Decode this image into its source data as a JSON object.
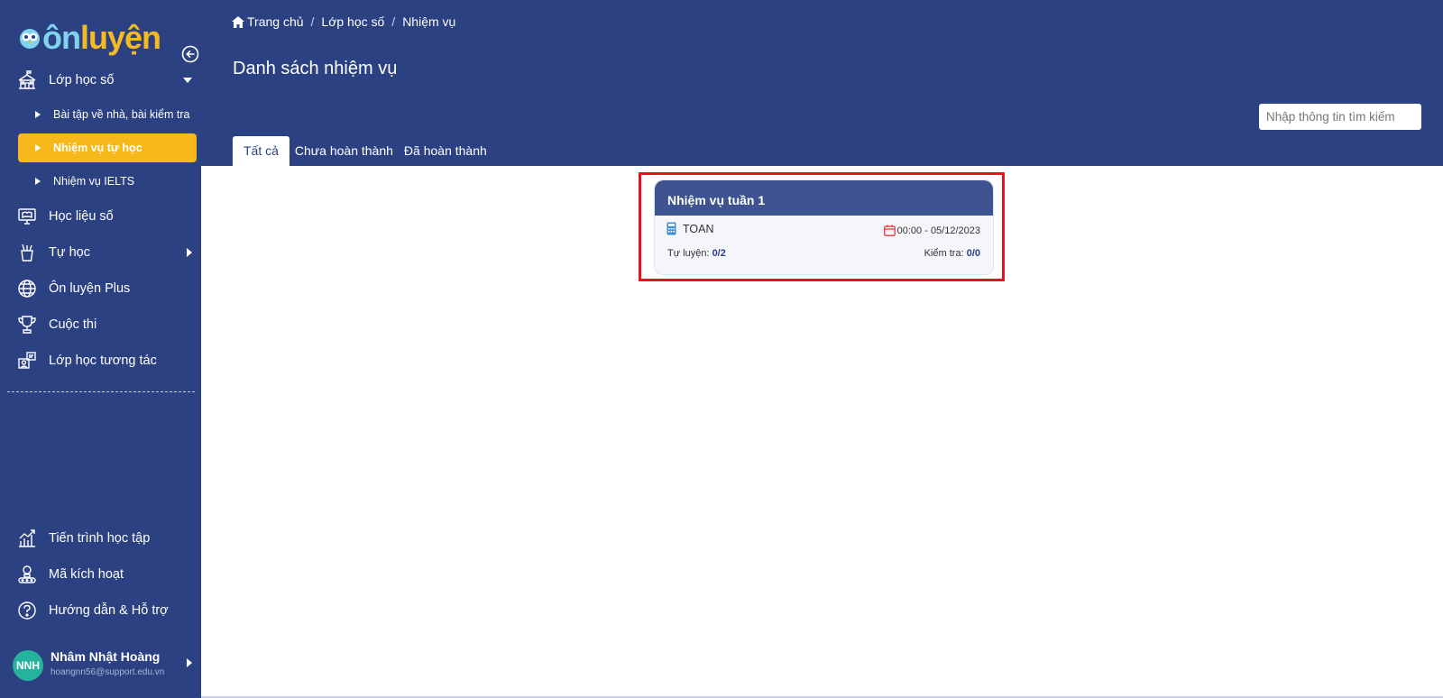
{
  "app": {
    "logo_text_on": "ôn",
    "logo_text_luyen": "luyện",
    "colors": {
      "primary": "#2c4182",
      "accent": "#f6b81b",
      "highlight": "#e8121d",
      "avatar": "#26b39e"
    }
  },
  "sidebar": {
    "items": [
      {
        "label": "Lớp học số",
        "icon": "school-icon"
      },
      {
        "label": "Học liệu số",
        "icon": "monitor-book-icon"
      },
      {
        "label": "Tự học",
        "icon": "pencil-cup-icon"
      },
      {
        "label": "Ôn luyện Plus",
        "icon": "globe-icon"
      },
      {
        "label": "Cuộc thi",
        "icon": "trophy-icon"
      },
      {
        "label": "Lớp học tương tác",
        "icon": "interactive-class-icon"
      }
    ],
    "sub_items": [
      {
        "label": "Bài tập về nhà, bài kiểm tra"
      },
      {
        "label": "Nhiệm vụ tự học"
      },
      {
        "label": "Nhiệm vụ IELTS"
      }
    ],
    "bottom_items": [
      {
        "label": "Tiến trình học tập",
        "icon": "chart-icon"
      },
      {
        "label": "Mã kích hoạt",
        "icon": "activation-code-icon"
      },
      {
        "label": "Hướng dẫn & Hỗ trợ",
        "icon": "help-icon"
      }
    ],
    "user": {
      "initials": "NNH",
      "name": "Nhâm Nhật Hoàng",
      "email": "hoangnn56@support.edu.vn"
    }
  },
  "header": {
    "breadcrumb": [
      "Trang chủ",
      "Lớp học số",
      "Nhiệm vụ"
    ],
    "title": "Danh sách nhiệm vụ",
    "search_placeholder": "Nhập thông tin tìm kiếm",
    "tabs": [
      "Tất cả",
      "Chưa hoàn thành",
      "Đã hoàn thành"
    ]
  },
  "tasks": [
    {
      "title": "Nhiệm vụ tuần 1",
      "subject": "TOAN",
      "datetime": "00:00 - 05/12/2023",
      "practice_label": "Tự luyện:",
      "practice_value": "0/2",
      "test_label": "Kiểm tra:",
      "test_value": "0/0"
    }
  ]
}
